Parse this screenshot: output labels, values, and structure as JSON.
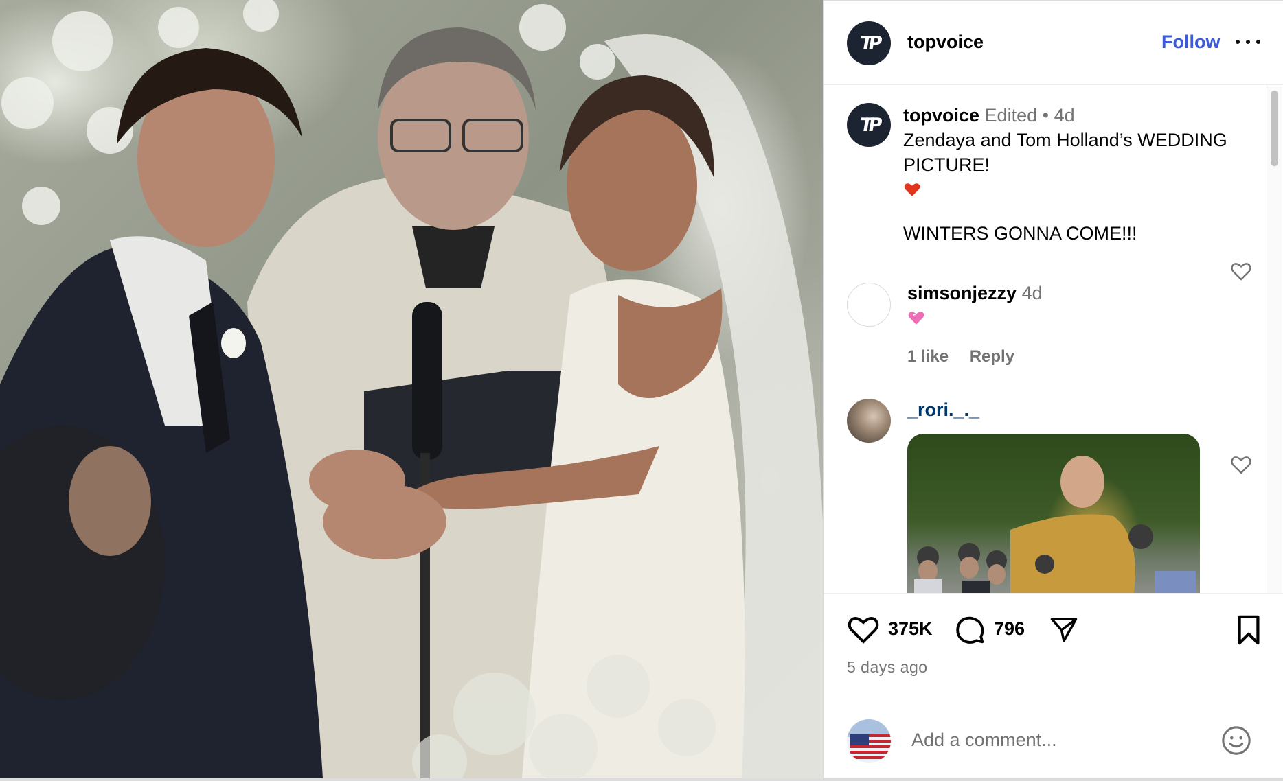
{
  "post": {
    "author": "topvoice",
    "author_initials": "TP",
    "follow_label": "Follow",
    "photo_alt": "Wedding ceremony photo"
  },
  "caption": {
    "username": "topvoice",
    "edited_label": "Edited",
    "separator": "•",
    "time": "4d",
    "line1": "Zendaya and Tom Holland’s WEDDING PICTURE!",
    "line2": "WINTERS GONNA COME!!!"
  },
  "comments": [
    {
      "username": "simsonjezzy",
      "time": "4d",
      "text_emoji": "pink-heart",
      "likes": "1 like",
      "reply_label": "Reply"
    },
    {
      "username": "_rori._._",
      "content": "gif"
    }
  ],
  "actions": {
    "likes": "375K",
    "comments": "796",
    "date": "5 days ago"
  },
  "add_comment": {
    "placeholder": "Add a comment..."
  },
  "icons": [
    "three-dots-icon",
    "heart-icon",
    "comment-icon",
    "share-icon",
    "bookmark-icon",
    "emoji-icon"
  ],
  "colors": {
    "follow": "#3b5bd9",
    "muted": "#737373",
    "avatar_bg": "#1c2431",
    "gif_username": "#00376b"
  }
}
